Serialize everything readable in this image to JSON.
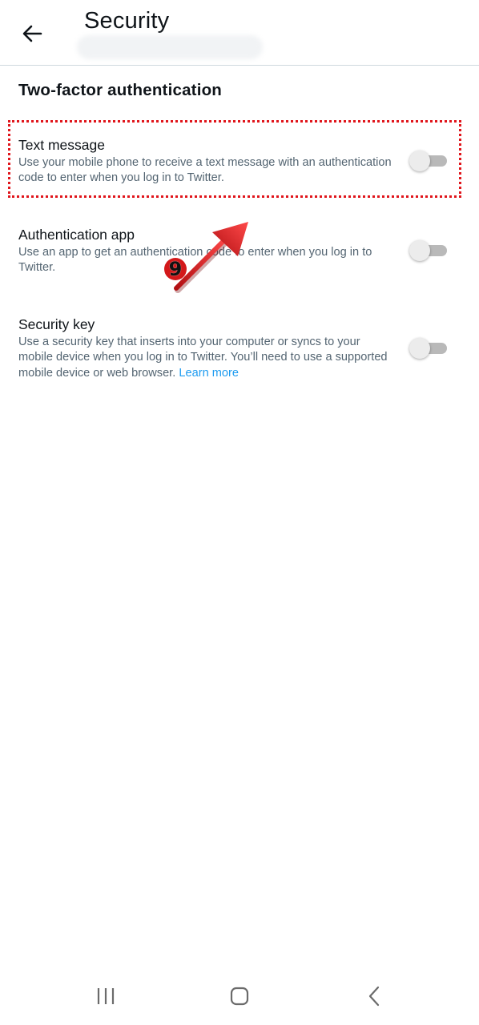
{
  "header": {
    "title": "Security",
    "back_icon": "arrow-left-icon"
  },
  "section": {
    "title": "Two-factor authentication"
  },
  "options": [
    {
      "title": "Text message",
      "description": "Use your mobile phone to receive a text message with an authentication code to enter when you log in to Twitter.",
      "enabled": false
    },
    {
      "title": "Authentication app",
      "description": "Use an app to get an authentication code to enter when you log in to Twitter.",
      "enabled": false
    },
    {
      "title": "Security key",
      "description": "Use a security key that inserts into your computer or syncs to your mobile device when you log in to Twitter. You’ll need to use a supported mobile device or web browser.",
      "link": "Learn more",
      "enabled": false
    }
  ],
  "annotation": {
    "step_number": "9",
    "color": "#e0151b"
  },
  "navbar": {
    "recents_icon": "recents-icon",
    "home_icon": "home-icon",
    "back_icon": "back-chevron-icon"
  },
  "colors": {
    "link": "#1d9bf0",
    "secondary_text": "#536471",
    "divider": "#cfd9de"
  }
}
